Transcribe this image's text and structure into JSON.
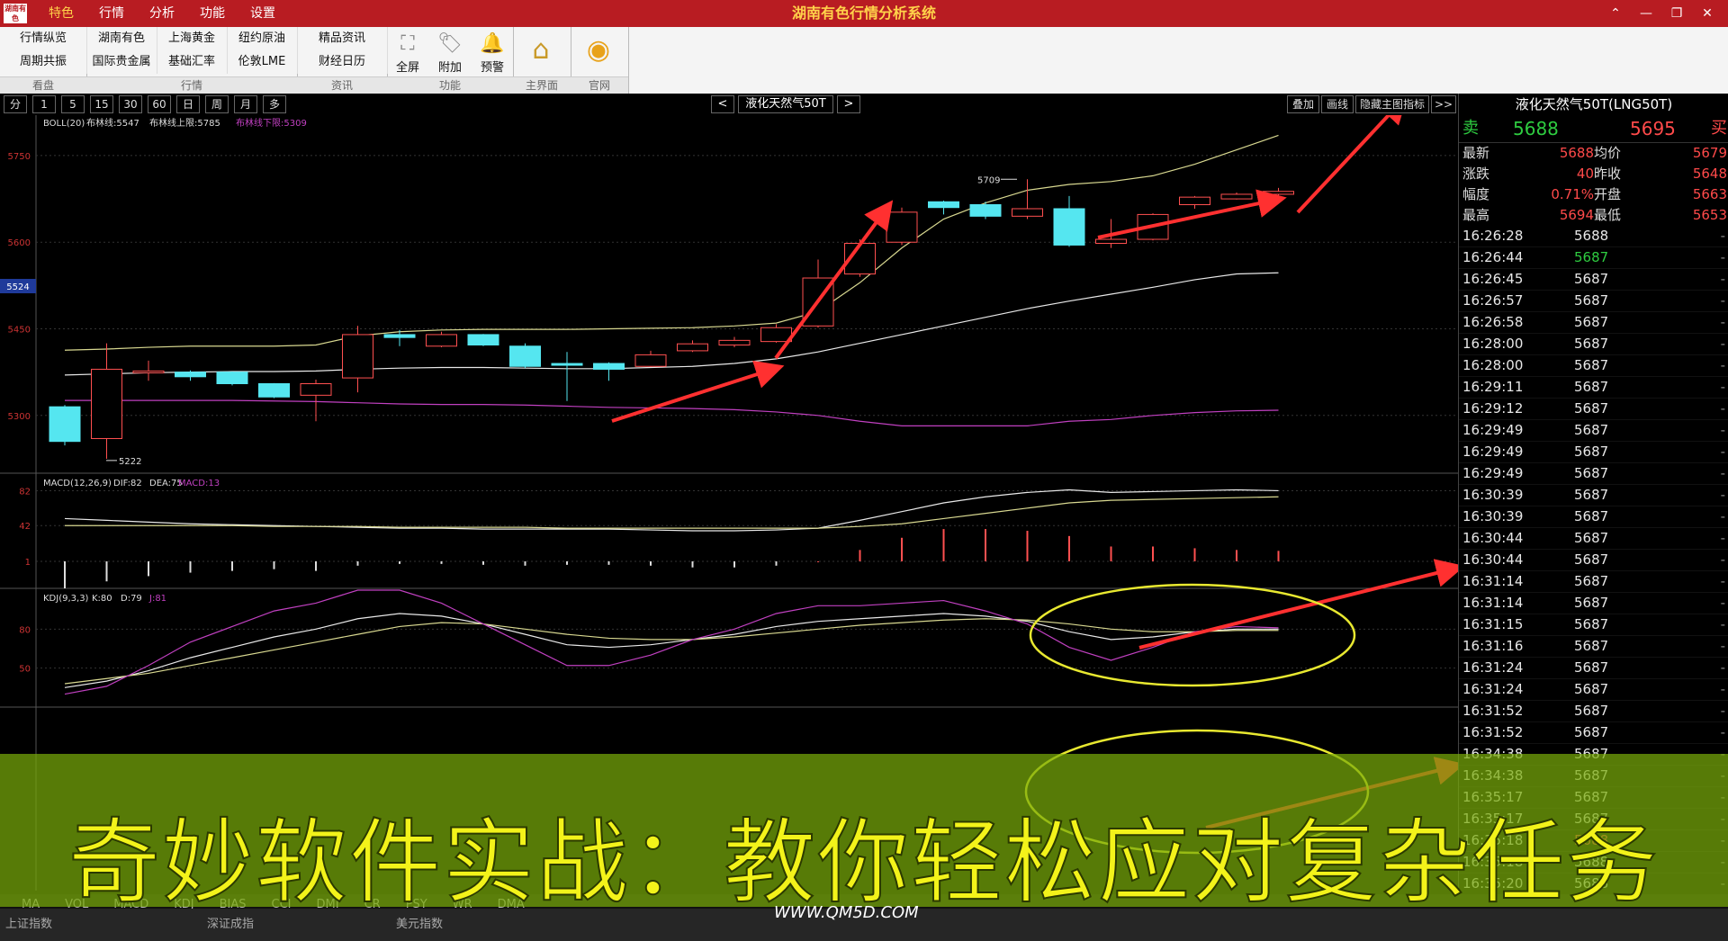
{
  "titlebar": {
    "logo": "湖南有色",
    "menu": [
      "特色",
      "行情",
      "分析",
      "功能",
      "设置"
    ],
    "app_title": "湖南有色行情分析系统",
    "win_buttons": [
      "⌃",
      "—",
      "❐",
      "✕"
    ]
  },
  "toolbar": {
    "groups": [
      {
        "label": "看盘",
        "buttons": [
          "行情纵览",
          "周期共振"
        ]
      },
      {
        "label": "行情",
        "buttons": [
          "湖南有色",
          "上海黄金",
          "纽约原油",
          "国际贵金属",
          "基础汇率",
          "伦敦LME"
        ]
      },
      {
        "label": "资讯",
        "buttons": [
          "精品资讯",
          "财经日历"
        ]
      },
      {
        "label": "功能",
        "buttons": [
          "全屏",
          "附加",
          "预警"
        ]
      },
      {
        "label": "主界面",
        "buttons": []
      },
      {
        "label": "官网",
        "buttons": []
      }
    ]
  },
  "periods": [
    "分",
    "1",
    "5",
    "15",
    "30",
    "60",
    "日",
    "周",
    "月",
    "多"
  ],
  "nav": {
    "prev": "<",
    "symbol": "液化天然气50T",
    "next": ">"
  },
  "chart_tools": [
    "叠加",
    "画线",
    "隐藏主图指标",
    ">>"
  ],
  "chart_data": [
    {
      "type": "candlestick",
      "indicator": "BOLL(20)",
      "legend": [
        "布林线:5547",
        "布林线上限:5785",
        "布林线下限:5309"
      ],
      "yticks": [
        5750,
        5600,
        5450,
        5300
      ],
      "current_label": "5524",
      "ylim": [
        5200,
        5820
      ],
      "annotations": [
        "5709",
        "5222"
      ],
      "candles": [
        {
          "o": 5315,
          "c": 5255,
          "h": 5318,
          "l": 5248
        },
        {
          "o": 5260,
          "c": 5380,
          "h": 5425,
          "l": 5225
        },
        {
          "o": 5375,
          "c": 5377,
          "h": 5395,
          "l": 5360
        },
        {
          "o": 5375,
          "c": 5367,
          "h": 5378,
          "l": 5360
        },
        {
          "o": 5375,
          "c": 5355,
          "h": 5376,
          "l": 5352
        },
        {
          "o": 5355,
          "c": 5332,
          "h": 5356,
          "l": 5330
        },
        {
          "o": 5335,
          "c": 5355,
          "h": 5362,
          "l": 5290
        },
        {
          "o": 5365,
          "c": 5440,
          "h": 5455,
          "l": 5340
        },
        {
          "o": 5440,
          "c": 5435,
          "h": 5448,
          "l": 5420
        },
        {
          "o": 5420,
          "c": 5440,
          "h": 5445,
          "l": 5418
        },
        {
          "o": 5440,
          "c": 5422,
          "h": 5441,
          "l": 5420
        },
        {
          "o": 5420,
          "c": 5385,
          "h": 5425,
          "l": 5382
        },
        {
          "o": 5390,
          "c": 5387,
          "h": 5410,
          "l": 5325
        },
        {
          "o": 5390,
          "c": 5380,
          "h": 5392,
          "l": 5360
        },
        {
          "o": 5385,
          "c": 5405,
          "h": 5412,
          "l": 5384
        },
        {
          "o": 5412,
          "c": 5424,
          "h": 5430,
          "l": 5410
        },
        {
          "o": 5422,
          "c": 5430,
          "h": 5436,
          "l": 5418
        },
        {
          "o": 5428,
          "c": 5452,
          "h": 5458,
          "l": 5426
        },
        {
          "o": 5455,
          "c": 5538,
          "h": 5570,
          "l": 5452
        },
        {
          "o": 5545,
          "c": 5598,
          "h": 5605,
          "l": 5540
        },
        {
          "o": 5600,
          "c": 5652,
          "h": 5660,
          "l": 5595
        },
        {
          "o": 5670,
          "c": 5660,
          "h": 5672,
          "l": 5648
        },
        {
          "o": 5665,
          "c": 5645,
          "h": 5670,
          "l": 5640
        },
        {
          "o": 5645,
          "c": 5658,
          "h": 5709,
          "l": 5640
        },
        {
          "o": 5658,
          "c": 5595,
          "h": 5680,
          "l": 5592
        },
        {
          "o": 5598,
          "c": 5605,
          "h": 5640,
          "l": 5590
        },
        {
          "o": 5605,
          "c": 5648,
          "h": 5650,
          "l": 5603
        },
        {
          "o": 5665,
          "c": 5678,
          "h": 5680,
          "l": 5658
        },
        {
          "o": 5675,
          "c": 5683,
          "h": 5686,
          "l": 5674
        },
        {
          "o": 5683,
          "c": 5688,
          "h": 5694,
          "l": 5679
        }
      ],
      "boll_upper": [
        5413,
        5415,
        5418,
        5420,
        5420,
        5420,
        5422,
        5438,
        5445,
        5448,
        5449,
        5449,
        5449,
        5450,
        5451,
        5452,
        5455,
        5460,
        5480,
        5530,
        5590,
        5640,
        5668,
        5690,
        5700,
        5705,
        5715,
        5735,
        5760,
        5785
      ],
      "boll_mid": [
        5370,
        5372,
        5374,
        5375,
        5376,
        5376,
        5377,
        5380,
        5382,
        5383,
        5383,
        5382,
        5381,
        5381,
        5383,
        5385,
        5390,
        5398,
        5410,
        5425,
        5440,
        5455,
        5470,
        5485,
        5498,
        5510,
        5522,
        5535,
        5545,
        5547
      ],
      "boll_lower": [
        5326,
        5326,
        5326,
        5326,
        5326,
        5325,
        5324,
        5322,
        5320,
        5319,
        5319,
        5318,
        5316,
        5314,
        5313,
        5312,
        5310,
        5306,
        5300,
        5290,
        5282,
        5282,
        5282,
        5282,
        5290,
        5293,
        5300,
        5305,
        5308,
        5309
      ]
    },
    {
      "type": "line",
      "indicator": "MACD(12,26,9)",
      "legend": [
        "DIF:82",
        "DEA:75",
        "MACD:13"
      ],
      "yticks": [
        82,
        42,
        1
      ],
      "ylim": [
        -30,
        100
      ],
      "dif": [
        50,
        48,
        46,
        44,
        43,
        42,
        41,
        40,
        39,
        39,
        38,
        38,
        38,
        38,
        37,
        36,
        36,
        37,
        39,
        48,
        58,
        68,
        75,
        80,
        83,
        80,
        81,
        82,
        83,
        82
      ],
      "dea": [
        42,
        42,
        42,
        42,
        42,
        41,
        41,
        41,
        40,
        40,
        40,
        40,
        39,
        39,
        39,
        39,
        39,
        39,
        39,
        41,
        44,
        50,
        56,
        62,
        68,
        71,
        72,
        73,
        74,
        75
      ],
      "macd": [
        -30,
        -22,
        -16,
        -12,
        -10,
        -8,
        -10,
        -4,
        -2,
        -2,
        -3,
        -4,
        -3,
        -3,
        -4,
        -6,
        -6,
        -4,
        0,
        14,
        28,
        38,
        38,
        36,
        30,
        18,
        18,
        16,
        14,
        13
      ]
    },
    {
      "type": "line",
      "indicator": "KDJ(9,3,3)",
      "legend": [
        "K:80",
        "D:79",
        "J:81"
      ],
      "yticks": [
        80,
        50
      ],
      "ylim": [
        20,
        110
      ],
      "k": [
        35,
        40,
        48,
        58,
        66,
        74,
        80,
        88,
        92,
        90,
        84,
        76,
        68,
        66,
        68,
        72,
        76,
        82,
        86,
        88,
        90,
        92,
        90,
        86,
        78,
        72,
        74,
        78,
        80,
        80
      ],
      "d": [
        38,
        42,
        46,
        52,
        58,
        64,
        70,
        76,
        82,
        85,
        84,
        80,
        76,
        73,
        72,
        72,
        74,
        77,
        80,
        83,
        85,
        87,
        88,
        87,
        84,
        80,
        78,
        78,
        79,
        79
      ],
      "j": [
        30,
        36,
        52,
        70,
        82,
        94,
        100,
        110,
        110,
        100,
        84,
        68,
        52,
        52,
        60,
        72,
        80,
        92,
        98,
        98,
        100,
        102,
        94,
        84,
        66,
        56,
        66,
        78,
        82,
        81
      ]
    }
  ],
  "quote": {
    "title": "液化天然气50T(LNG50T)",
    "sell_label": "卖",
    "sell_price": "5688",
    "buy_price": "5695",
    "buy_label": "买",
    "rows": [
      {
        "l1": "最新",
        "v1": "5688",
        "l2": "均价",
        "v2": "5679"
      },
      {
        "l1": "涨跌",
        "v1": "40",
        "l2": "昨收",
        "v2": "5648"
      },
      {
        "l1": "幅度",
        "v1": "0.71%",
        "l2": "开盘",
        "v2": "5663"
      },
      {
        "l1": "最高",
        "v1": "5694",
        "l2": "最低",
        "v2": "5653"
      }
    ],
    "ticks": [
      {
        "time": "16:26:28",
        "price": "5688",
        "color": "#e8e8e8"
      },
      {
        "time": "16:26:44",
        "price": "5687",
        "color": "#2ecc40"
      },
      {
        "time": "16:26:45",
        "price": "5687",
        "color": "#e8e8e8"
      },
      {
        "time": "16:26:57",
        "price": "5687",
        "color": "#e8e8e8"
      },
      {
        "time": "16:26:58",
        "price": "5687",
        "color": "#e8e8e8"
      },
      {
        "time": "16:28:00",
        "price": "5687",
        "color": "#e8e8e8"
      },
      {
        "time": "16:28:00",
        "price": "5687",
        "color": "#e8e8e8"
      },
      {
        "time": "16:29:11",
        "price": "5687",
        "color": "#e8e8e8"
      },
      {
        "time": "16:29:12",
        "price": "5687",
        "color": "#e8e8e8"
      },
      {
        "time": "16:29:49",
        "price": "5687",
        "color": "#e8e8e8"
      },
      {
        "time": "16:29:49",
        "price": "5687",
        "color": "#e8e8e8"
      },
      {
        "time": "16:29:49",
        "price": "5687",
        "color": "#e8e8e8"
      },
      {
        "time": "16:30:39",
        "price": "5687",
        "color": "#e8e8e8"
      },
      {
        "time": "16:30:39",
        "price": "5687",
        "color": "#e8e8e8"
      },
      {
        "time": "16:30:44",
        "price": "5687",
        "color": "#e8e8e8"
      },
      {
        "time": "16:30:44",
        "price": "5687",
        "color": "#e8e8e8"
      },
      {
        "time": "16:31:14",
        "price": "5687",
        "color": "#e8e8e8"
      },
      {
        "time": "16:31:14",
        "price": "5687",
        "color": "#e8e8e8"
      },
      {
        "time": "16:31:15",
        "price": "5687",
        "color": "#e8e8e8"
      },
      {
        "time": "16:31:16",
        "price": "5687",
        "color": "#e8e8e8"
      },
      {
        "time": "16:31:24",
        "price": "5687",
        "color": "#e8e8e8"
      },
      {
        "time": "16:31:24",
        "price": "5687",
        "color": "#e8e8e8"
      },
      {
        "time": "16:31:52",
        "price": "5687",
        "color": "#e8e8e8"
      },
      {
        "time": "16:31:52",
        "price": "5687",
        "color": "#e8e8e8"
      },
      {
        "time": "16:34:38",
        "price": "5687",
        "color": "#e8e8e8"
      },
      {
        "time": "16:34:38",
        "price": "5687",
        "color": "#e8e8e8"
      },
      {
        "time": "16:35:17",
        "price": "5687",
        "color": "#e8e8e8"
      },
      {
        "time": "16:35:17",
        "price": "5687",
        "color": "#e8e8e8"
      },
      {
        "time": "16:35:18",
        "price": "5688",
        "color": "#ff4a4a"
      },
      {
        "time": "16:35:18",
        "price": "5688",
        "color": "#e8e8e8"
      },
      {
        "time": "16:35:20",
        "price": "5688",
        "color": "#e8e8e8"
      },
      {
        "time": "16:35:20",
        "price": "5688",
        "color": "#e8e8e8"
      }
    ]
  },
  "bottom_tabs": [
    "MA",
    "VOL",
    "MACD",
    "KDJ",
    "BIAS",
    "CCI",
    "DMI",
    "CR",
    "PSY",
    "WR",
    "DMA"
  ],
  "status": {
    "left": "上证指数",
    "mid": "深证成指",
    "right": "美元指数"
  },
  "caption": "奇妙软件实战：教你轻松应对复杂任务",
  "watermark": "WWW.QM5D.COM",
  "colors": {
    "up": "#ff5050",
    "down": "#55e6f0",
    "boll_upper": "#d8d890",
    "boll_mid": "#e8e8e8",
    "boll_lower": "#c040c0",
    "arrow": "#ff3030",
    "ellipse": "#e8e830"
  }
}
